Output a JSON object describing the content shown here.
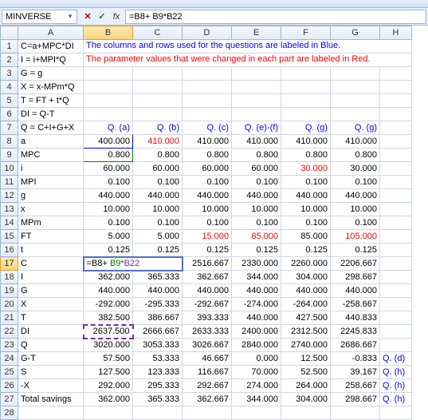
{
  "nameBox": "MINVERSE",
  "formula": "=B8+ B9*B22",
  "colHeaders": [
    "A",
    "B",
    "C",
    "D",
    "E",
    "F",
    "G",
    "H"
  ],
  "rowHeaders": [
    "1",
    "2",
    "3",
    "4",
    "5",
    "6",
    "7",
    "8",
    "9",
    "10",
    "11",
    "12",
    "13",
    "14",
    "15",
    "16",
    "17",
    "18",
    "19",
    "20",
    "21",
    "22",
    "23",
    "24",
    "25",
    "26",
    "27",
    "28"
  ],
  "notes": {
    "line1": "The columns and rows used for the questions are labeled in Blue.",
    "line2": "The parameter values that were changed in each part are labeled in Red."
  },
  "labels": {
    "r1": "C=a+MPC*DI",
    "r2": "I = i+MPI*Q",
    "r3": "G = g",
    "r4": "X = x-MPm*Q",
    "r5": "T = FT + t*Q",
    "r6": "DI = Q-T",
    "r7": "Q = C+I+G+X",
    "r8": "a",
    "r9": "MPC",
    "r10": "i",
    "r11": "MPI",
    "r12": "g",
    "r13": "x",
    "r14": "MPm",
    "r15": "FT",
    "r16": "t",
    "r17": "C",
    "r18": "I",
    "r19": "G",
    "r20": "X",
    "r21": "T",
    "r22": "DI",
    "r23": "Q",
    "r24": "G-T",
    "r25": "S",
    "r26": "-X",
    "r27": "Total savings"
  },
  "qheaders": {
    "b": "Q. (a)",
    "c": "Q. (b)",
    "d": "Q. (c)",
    "e": "Q. (e)-(f)",
    "f": "Q. (g)",
    "g": "Q. (g)"
  },
  "sideQ": {
    "r24": "Q. (d)",
    "r25": "Q. (h)",
    "r26": "Q. (h)",
    "r27": "Q. (h)"
  },
  "editCell": {
    "pre": "=B8+ ",
    "mid": "B9*",
    "post": "B22"
  },
  "chart_data": {
    "type": "table",
    "columns": [
      "row",
      "A",
      "B",
      "C",
      "D",
      "E",
      "F",
      "G"
    ],
    "rows": [
      {
        "row": 8,
        "A": "a",
        "B": "400.000",
        "C": "410.000",
        "D": "410.000",
        "E": "410.000",
        "F": "410.000",
        "G": "410.000"
      },
      {
        "row": 9,
        "A": "MPC",
        "B": "0.800",
        "C": "0.800",
        "D": "0.800",
        "E": "0.800",
        "F": "0.800",
        "G": "0.800"
      },
      {
        "row": 10,
        "A": "i",
        "B": "60.000",
        "C": "60.000",
        "D": "60.000",
        "E": "60.000",
        "F": "30.000",
        "G": "30.000"
      },
      {
        "row": 11,
        "A": "MPI",
        "B": "0.100",
        "C": "0.100",
        "D": "0.100",
        "E": "0.100",
        "F": "0.100",
        "G": "0.100"
      },
      {
        "row": 12,
        "A": "g",
        "B": "440.000",
        "C": "440.000",
        "D": "440.000",
        "E": "440.000",
        "F": "440.000",
        "G": "440.000"
      },
      {
        "row": 13,
        "A": "x",
        "B": "10.000",
        "C": "10.000",
        "D": "10.000",
        "E": "10.000",
        "F": "10.000",
        "G": "10.000"
      },
      {
        "row": 14,
        "A": "MPm",
        "B": "0.100",
        "C": "0.100",
        "D": "0.100",
        "E": "0.100",
        "F": "0.100",
        "G": "0.100"
      },
      {
        "row": 15,
        "A": "FT",
        "B": "5.000",
        "C": "5.000",
        "D": "15.000",
        "E": "85.000",
        "F": "85.000",
        "G": "105.000"
      },
      {
        "row": 16,
        "A": "t",
        "B": "0.125",
        "C": "0.125",
        "D": "0.125",
        "E": "0.125",
        "F": "0.125",
        "G": "0.125"
      },
      {
        "row": 17,
        "A": "C",
        "B": "=B8+ B9*B22",
        "C": "",
        "D": "2516.667",
        "E": "2330.000",
        "F": "2260.000",
        "G": "2206.667"
      },
      {
        "row": 18,
        "A": "I",
        "B": "362.000",
        "C": "365.333",
        "D": "362.667",
        "E": "344.000",
        "F": "304.000",
        "G": "298.667"
      },
      {
        "row": 19,
        "A": "G",
        "B": "440.000",
        "C": "440.000",
        "D": "440.000",
        "E": "440.000",
        "F": "440.000",
        "G": "440.000"
      },
      {
        "row": 20,
        "A": "X",
        "B": "-292.000",
        "C": "-295.333",
        "D": "-292.667",
        "E": "-274.000",
        "F": "-264.000",
        "G": "-258.667"
      },
      {
        "row": 21,
        "A": "T",
        "B": "382.500",
        "C": "386.667",
        "D": "393.333",
        "E": "440.000",
        "F": "427.500",
        "G": "440.833"
      },
      {
        "row": 22,
        "A": "DI",
        "B": "2637.500",
        "C": "2666.667",
        "D": "2633.333",
        "E": "2400.000",
        "F": "2312.500",
        "G": "2245.833"
      },
      {
        "row": 23,
        "A": "Q",
        "B": "3020.000",
        "C": "3053.333",
        "D": "3026.667",
        "E": "2840.000",
        "F": "2740.000",
        "G": "2686.667"
      },
      {
        "row": 24,
        "A": "G-T",
        "B": "57.500",
        "C": "53.333",
        "D": "46.667",
        "E": "0.000",
        "F": "12.500",
        "G": "-0.833"
      },
      {
        "row": 25,
        "A": "S",
        "B": "127.500",
        "C": "123.333",
        "D": "116.667",
        "E": "70.000",
        "F": "52.500",
        "G": "39.167"
      },
      {
        "row": 26,
        "A": "-X",
        "B": "292.000",
        "C": "295.333",
        "D": "292.667",
        "E": "274.000",
        "F": "264.000",
        "G": "258.667"
      },
      {
        "row": 27,
        "A": "Total savings",
        "B": "362.000",
        "C": "365.333",
        "D": "362.667",
        "E": "344.000",
        "F": "304.000",
        "G": "298.667"
      }
    ],
    "red_cells": [
      "C8",
      "D15",
      "E15",
      "F10",
      "F15",
      "G10",
      "G15"
    ],
    "blue_columns_header_row": 7,
    "blue_side_labels_rows": [
      24,
      25,
      26,
      27
    ]
  }
}
